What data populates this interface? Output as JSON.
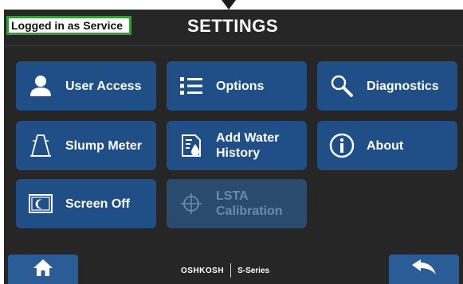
{
  "header": {
    "login_status": "Logged in as Service",
    "title": "SETTINGS"
  },
  "tiles": [
    {
      "label_lines": [
        "User Access"
      ],
      "icon": "user-icon",
      "enabled": true
    },
    {
      "label_lines": [
        "Options"
      ],
      "icon": "list-icon",
      "enabled": true
    },
    {
      "label_lines": [
        "Diagnostics"
      ],
      "icon": "magnifier-icon",
      "enabled": true
    },
    {
      "label_lines": [
        "Slump Meter"
      ],
      "icon": "slump-cone-icon",
      "enabled": true
    },
    {
      "label_lines": [
        "Add Water",
        "History"
      ],
      "icon": "water-history-icon",
      "enabled": true
    },
    {
      "label_lines": [
        "About"
      ],
      "icon": "info-icon",
      "enabled": true
    },
    {
      "label_lines": [
        "Screen Off"
      ],
      "icon": "screen-moon-icon",
      "enabled": true
    },
    {
      "label_lines": [
        "LSTA",
        "Calibration"
      ],
      "icon": "crosshair-icon",
      "enabled": false
    }
  ],
  "footer": {
    "brand_logo": "OSHKOSH",
    "brand_series": "S-Series",
    "home_icon": "home-icon",
    "back_icon": "back-arrow-icon"
  },
  "colors": {
    "background": "#262626",
    "tile": "#1f4f86",
    "tile_disabled": "#2a4a6e",
    "login_border": "#3a9a3a",
    "nav_button": "#2a5d96"
  }
}
